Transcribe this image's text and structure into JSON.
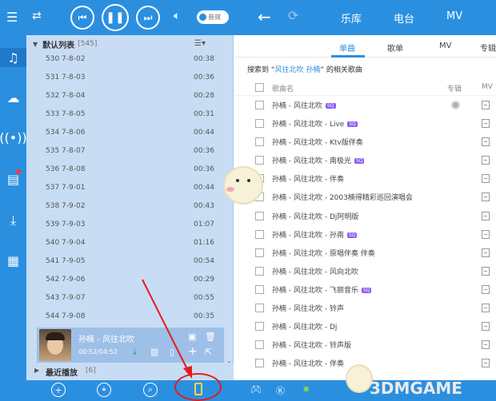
{
  "topbar": {
    "sound_effect_label": "音效",
    "nav": [
      "乐库",
      "电台",
      "MV"
    ]
  },
  "playlist": {
    "title": "默认列表",
    "count": "[545]",
    "rows": [
      {
        "name": "530 7-8-02",
        "dur": "00:38"
      },
      {
        "name": "531 7-8-03",
        "dur": "00:36"
      },
      {
        "name": "532 7-8-04",
        "dur": "00:28"
      },
      {
        "name": "533 7-8-05",
        "dur": "00:31"
      },
      {
        "name": "534 7-8-06",
        "dur": "00:44"
      },
      {
        "name": "535 7-8-07",
        "dur": "00:36"
      },
      {
        "name": "536 7-8-08",
        "dur": "00:36"
      },
      {
        "name": "537 7-9-01",
        "dur": "00:44"
      },
      {
        "name": "538 7-9-02",
        "dur": "00:43"
      },
      {
        "name": "539 7-9-03",
        "dur": "01:07"
      },
      {
        "name": "540 7-9-04",
        "dur": "01:16"
      },
      {
        "name": "541 7-9-05",
        "dur": "00:54"
      },
      {
        "name": "542 7-9-06",
        "dur": "00:29"
      },
      {
        "name": "543 7-9-07",
        "dur": "00:55"
      },
      {
        "name": "544 7-9-08",
        "dur": "00:35"
      }
    ]
  },
  "now_playing": {
    "title": "孙楠 - 风往北吹",
    "time": "00:52/04:52"
  },
  "recent": {
    "title": "最近播放",
    "count": "[6]"
  },
  "main": {
    "tabs": [
      "单曲",
      "歌单",
      "MV",
      "专辑"
    ],
    "search_prefix": "搜索到 “",
    "search_keyword": "风往北吹 孙楠",
    "search_suffix": "” 的相关歌曲",
    "col_song": "歌曲名",
    "col_album": "专辑",
    "col_mv": "MV",
    "songs": [
      {
        "title": "孙楠 - 风往北吹",
        "sq": true
      },
      {
        "title": "孙楠 - 风往北吹 - Live",
        "sq": true
      },
      {
        "title": "孙楠 - 风往北吹 - Ktv版伴奏",
        "sq": false
      },
      {
        "title": "孙楠 - 风往北吹 - 南极光",
        "sq": true
      },
      {
        "title": "孙楠 - 风往北吹 - 伴奏",
        "sq": false
      },
      {
        "title": "孙楠 - 风往北吹 - 2003楠得精彩巡回演唱会",
        "sq": false
      },
      {
        "title": "孙楠 - 风往北吹 - Dj阿明版",
        "sq": false
      },
      {
        "title": "孙楠 - 风往北吹 - 孙南",
        "sq": true
      },
      {
        "title": "孙楠 - 风往北吹 - 原唱伴奏 伴奏",
        "sq": false
      },
      {
        "title": "孙楠 - 风往北吹 - 风向北吹",
        "sq": false
      },
      {
        "title": "孙楠 - 风往北吹 - 飞丽音乐",
        "sq": true
      },
      {
        "title": "孙楠 - 风往北吹 - 铃声",
        "sq": false
      },
      {
        "title": "孙楠 - 风往北吹 - Dj",
        "sq": false
      },
      {
        "title": "孙楠 - 风往北吹 - 铃声版",
        "sq": false
      },
      {
        "title": "孙楠 - 风往北吹 - 伴奏",
        "sq": false
      }
    ],
    "sq_label": "SQ"
  },
  "watermark": "3DMGAME",
  "colors": {
    "accent": "#2b8fe0",
    "panel": "#c8ddf4",
    "sq_badge": "#8a5cf0",
    "annotation": "#e31c1c"
  }
}
